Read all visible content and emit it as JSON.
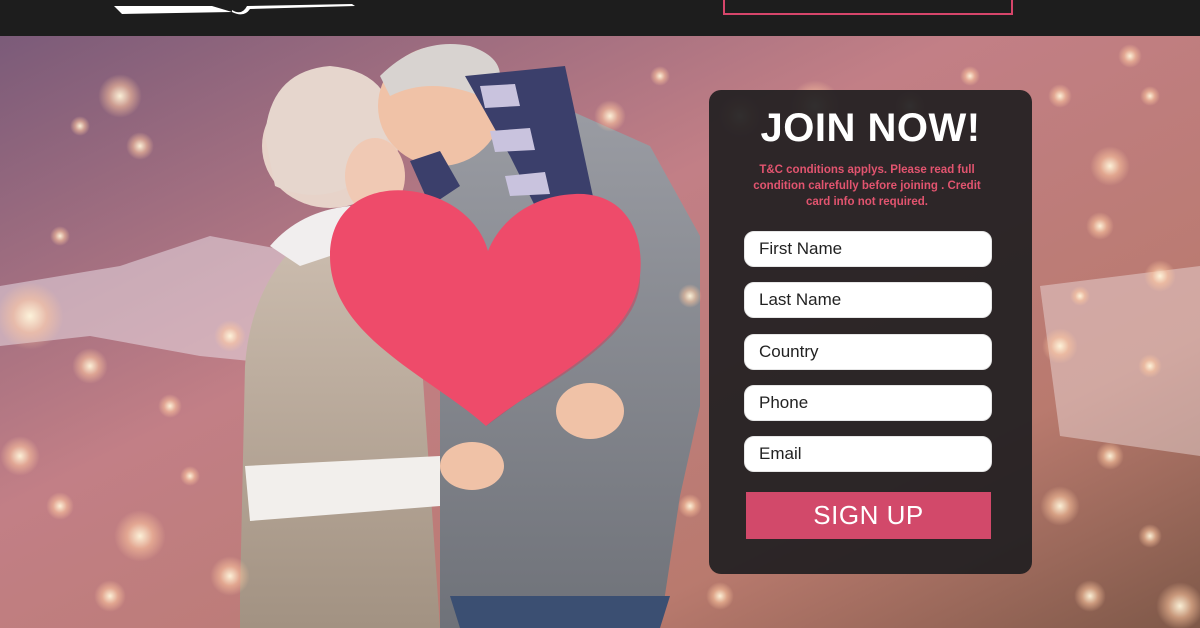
{
  "header": {
    "logo_name": "logo-mark",
    "cta_label": "",
    "accent_color": "#d6456a"
  },
  "hero": {
    "image_description_icon": "couple-with-heart-photo"
  },
  "join": {
    "title": "JOIN NOW!",
    "note": "T&C conditions applys. Please read full condition calrefully before joining . Credit card info not required.",
    "fields": [
      {
        "name": "first-name-field",
        "placeholder": "First Name"
      },
      {
        "name": "last-name-field",
        "placeholder": "Last Name"
      },
      {
        "name": "country-field",
        "placeholder": "Country"
      },
      {
        "name": "phone-field",
        "placeholder": "Phone"
      },
      {
        "name": "email-field",
        "placeholder": "Email"
      }
    ],
    "signup_label": "SIGN UP",
    "button_color": "#d2496a",
    "note_color": "#e2546f"
  }
}
